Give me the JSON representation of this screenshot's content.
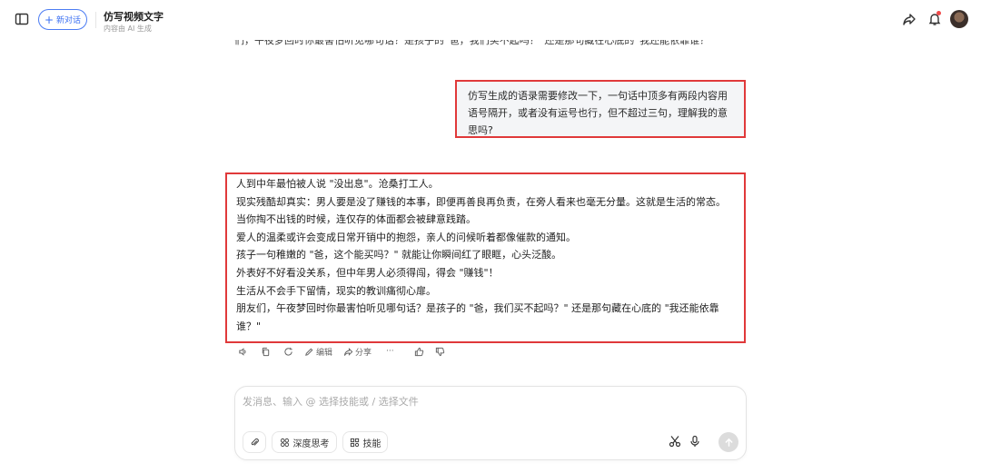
{
  "header": {
    "new_chat_label": "新对话",
    "chat_title": "仿写视频文字",
    "chat_subtitle": "内容由 AI 生成"
  },
  "conversation": {
    "truncated_line": "们，午夜梦回时你最害怕听见哪句话？是孩子的“爸，我们买不起吗？”还是那句藏在心底的“我还能依靠谁？”",
    "user_message": "仿写生成的语录需要修改一下，一句话中顶多有两段内容用语号隔开，或者没有运号也行，但不超过三句，理解我的意思吗?",
    "ai_lines": [
      "人到中年最怕被人说 \"没出息\"。沧桑打工人。",
      "现实残酷却真实：男人要是没了赚钱的本事，即便再善良再负责，在旁人看来也毫无分量。这就是生活的常态。",
      "当你掏不出钱的时候，连仅存的体面都会被肆意践踏。",
      "爱人的温柔或许会变成日常开销中的抱怨，亲人的问候听着都像催款的通知。",
      "孩子一句稚嫩的 \"爸，这个能买吗？\" 就能让你瞬间红了眼眶，心头泛酸。",
      "外表好不好看没关系，但中年男人必须得闯，得会 \"赚钱\"！",
      "生活从不会手下留情，现实的教训痛彻心扉。",
      "朋友们，午夜梦回时你最害怕听见哪句话？是孩子的 \"爸，我们买不起吗？\" 还是那句藏在心底的 \"我还能依靠",
      "谁？\""
    ],
    "actions": {
      "edit_label": "编辑",
      "share_label": "分享",
      "more_label": "···"
    }
  },
  "composer": {
    "placeholder": "发消息、输入 @ 选择技能或 / 选择文件",
    "deep_think_label": "深度思考",
    "skills_label": "技能"
  },
  "colors": {
    "accent": "#3a6ff2",
    "highlight_border": "#e0393a",
    "user_bubble_bg": "#f4f5f7"
  }
}
